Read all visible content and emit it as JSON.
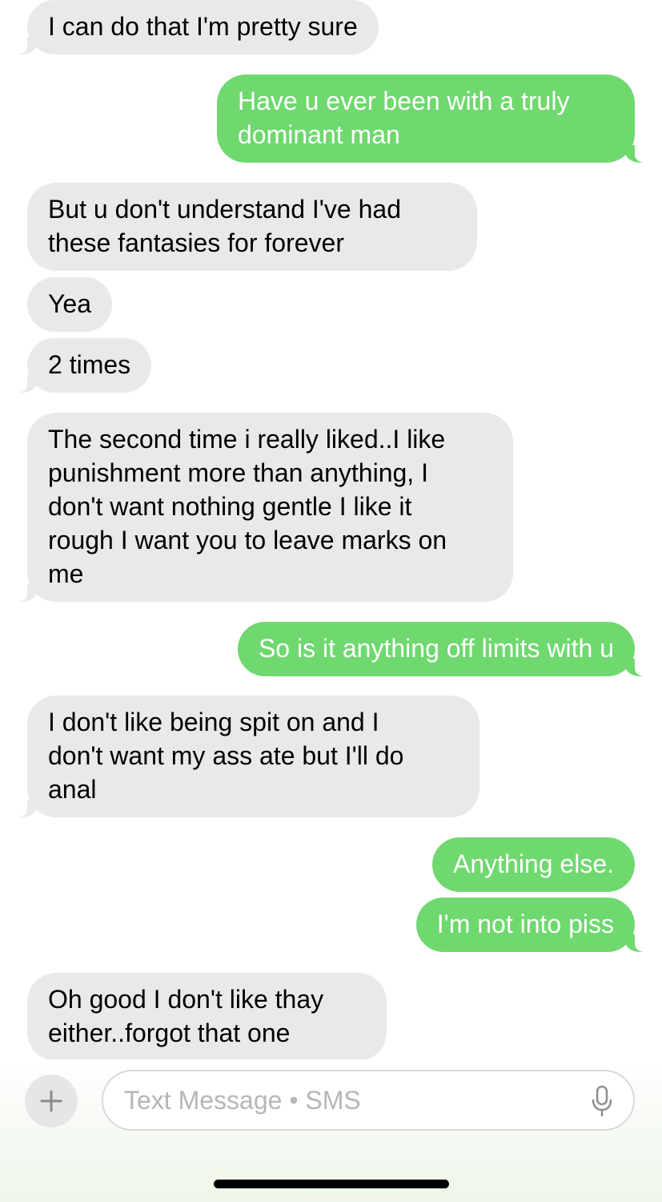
{
  "thread": {
    "messages": [
      {
        "direction": "incoming",
        "text": "I can do that I'm pretty sure"
      },
      {
        "direction": "outgoing",
        "text": "Have u ever been with a truly\ndominant man"
      },
      {
        "direction": "incoming",
        "text": "But u don't understand I've had\nthese fantasies for forever"
      },
      {
        "direction": "incoming",
        "text": "Yea"
      },
      {
        "direction": "incoming",
        "text": "2 times"
      },
      {
        "direction": "incoming",
        "text": "The second time i really liked..I like\npunishment more than anything,  I\ndon't want nothing gentle I like it\nrough I want you to leave marks on\nme"
      },
      {
        "direction": "outgoing",
        "text": "So is it anything off limits with u"
      },
      {
        "direction": "incoming",
        "text": "I don't like being spit on and I\ndon't want my ass ate but I'll do\nanal"
      },
      {
        "direction": "outgoing",
        "text": "Anything else."
      },
      {
        "direction": "outgoing",
        "text": "I'm not into piss"
      },
      {
        "direction": "incoming",
        "text": "Oh good I don't like thay\neither..forgot that one"
      }
    ]
  },
  "composer": {
    "placeholder": "Text Message • SMS",
    "plus_icon": "plus-icon",
    "mic_icon": "microphone-icon"
  },
  "colors": {
    "incoming_bubble": "#e9e9eb",
    "outgoing_bubble": "#6fd86f",
    "outgoing_text": "#ffffff",
    "incoming_text": "#000000"
  }
}
